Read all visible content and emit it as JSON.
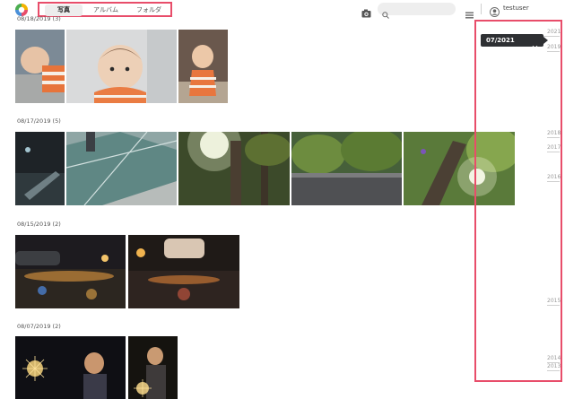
{
  "header": {
    "logo_icon": "app-logo-icon",
    "tabs": [
      {
        "label": "写真",
        "active": true
      },
      {
        "label": "アルバム",
        "active": false
      },
      {
        "label": "フォルダ",
        "active": false
      }
    ],
    "upload_icon": "camera-upload-icon",
    "search": {
      "icon": "search-icon",
      "placeholder": ""
    },
    "view_icon": "list-view-icon",
    "user": {
      "icon": "user-avatar-icon",
      "name": "testuser"
    }
  },
  "groups": [
    {
      "date_label": "08/18/2019 (3)",
      "photos": [
        "baby-lying-down",
        "baby-portrait",
        "baby-sitting"
      ]
    },
    {
      "date_label": "08/17/2019 (5)",
      "photos": [
        "night-street",
        "glass-floor",
        "sunlit-forest",
        "green-foliage",
        "sun-through-tree"
      ]
    },
    {
      "date_label": "08/15/2019 (2)",
      "photos": [
        "night-reflections",
        "car-lights-reflection"
      ]
    },
    {
      "date_label": "08/07/2019 (2)",
      "photos": [
        "child-sparklers",
        "child-sparkler-portrait"
      ]
    }
  ],
  "timeline": {
    "popup_label": "07/2021",
    "popup_icon": "chevron-down-icon",
    "years": [
      "2021",
      "2019",
      "2018",
      "2017",
      "2016",
      "2015",
      "2014",
      "2013"
    ]
  },
  "colors": {
    "highlight_border": "#e84d6a",
    "popup_bg": "#2e3033"
  }
}
